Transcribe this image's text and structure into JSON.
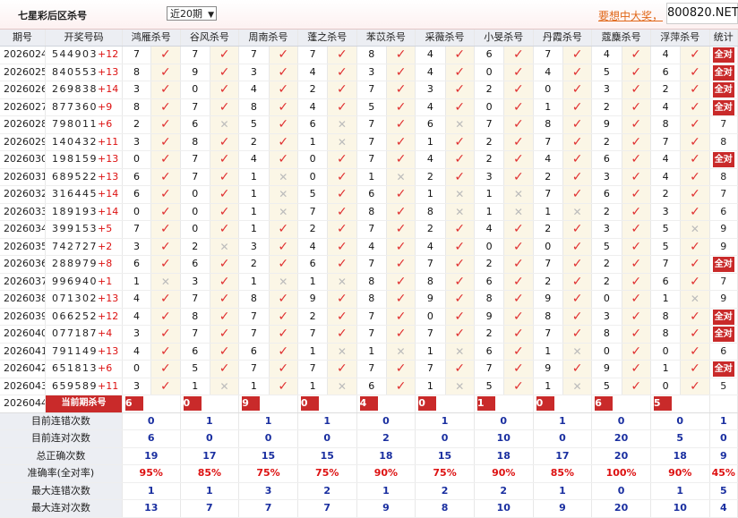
{
  "header": {
    "title": "七星彩后区杀号",
    "period_select": "近20期",
    "ad_text": "要想中大奖，",
    "watermark": "800820.NET"
  },
  "columns": [
    "期号",
    "开奖号码",
    "鸿雁杀号",
    "谷风杀号",
    "周南杀号",
    "蓬之杀号",
    "苯苡杀号",
    "采薇杀号",
    "小旻杀号",
    "丹霞杀号",
    "蔻麋杀号",
    "浮萍杀号",
    "统计"
  ],
  "rows": [
    {
      "issue": "2026024",
      "nums": "544903",
      "sum": "+12",
      "v": [
        "7",
        "7",
        "7",
        "7",
        "8",
        "4",
        "6",
        "7",
        "4",
        "4"
      ],
      "m": [
        "ok",
        "ok",
        "ok",
        "ok",
        "ok",
        "ok",
        "ok",
        "ok",
        "ok",
        "ok"
      ],
      "stat": "全对"
    },
    {
      "issue": "2026025",
      "nums": "840553",
      "sum": "+13",
      "v": [
        "8",
        "9",
        "3",
        "4",
        "3",
        "4",
        "0",
        "4",
        "5",
        "6"
      ],
      "m": [
        "ok",
        "ok",
        "ok",
        "ok",
        "ok",
        "ok",
        "ok",
        "ok",
        "ok",
        "ok"
      ],
      "stat": "全对"
    },
    {
      "issue": "2026026",
      "nums": "269838",
      "sum": "+14",
      "v": [
        "3",
        "0",
        "4",
        "2",
        "7",
        "3",
        "2",
        "0",
        "3",
        "2"
      ],
      "m": [
        "ok",
        "ok",
        "ok",
        "ok",
        "ok",
        "ok",
        "ok",
        "ok",
        "ok",
        "ok"
      ],
      "stat": "全对"
    },
    {
      "issue": "2026027",
      "nums": "877360",
      "sum": "+9",
      "v": [
        "8",
        "7",
        "8",
        "4",
        "5",
        "4",
        "0",
        "1",
        "2",
        "4"
      ],
      "m": [
        "ok",
        "ok",
        "ok",
        "ok",
        "ok",
        "ok",
        "ok",
        "ok",
        "ok",
        "ok"
      ],
      "stat": "全对"
    },
    {
      "issue": "2026028",
      "nums": "798011",
      "sum": "+6",
      "v": [
        "2",
        "6",
        "5",
        "6",
        "7",
        "6",
        "7",
        "8",
        "9",
        "8"
      ],
      "m": [
        "ok",
        "no",
        "ok",
        "no",
        "ok",
        "no",
        "ok",
        "ok",
        "ok",
        "ok"
      ],
      "stat": "7"
    },
    {
      "issue": "2026029",
      "nums": "140432",
      "sum": "+11",
      "v": [
        "3",
        "8",
        "2",
        "1",
        "7",
        "1",
        "2",
        "7",
        "2",
        "7"
      ],
      "m": [
        "ok",
        "ok",
        "ok",
        "no",
        "ok",
        "ok",
        "ok",
        "ok",
        "ok",
        "ok"
      ],
      "stat": "8"
    },
    {
      "issue": "2026030",
      "nums": "198159",
      "sum": "+13",
      "v": [
        "0",
        "7",
        "4",
        "0",
        "7",
        "4",
        "2",
        "4",
        "6",
        "4"
      ],
      "m": [
        "ok",
        "ok",
        "ok",
        "ok",
        "ok",
        "ok",
        "ok",
        "ok",
        "ok",
        "ok"
      ],
      "stat": "全对"
    },
    {
      "issue": "2026031",
      "nums": "689522",
      "sum": "+13",
      "v": [
        "6",
        "7",
        "1",
        "0",
        "1",
        "2",
        "3",
        "2",
        "3",
        "4"
      ],
      "m": [
        "ok",
        "ok",
        "no",
        "ok",
        "no",
        "ok",
        "ok",
        "ok",
        "ok",
        "ok"
      ],
      "stat": "8"
    },
    {
      "issue": "2026032",
      "nums": "316445",
      "sum": "+14",
      "v": [
        "6",
        "0",
        "1",
        "5",
        "6",
        "1",
        "1",
        "7",
        "6",
        "2"
      ],
      "m": [
        "ok",
        "ok",
        "no",
        "ok",
        "ok",
        "no",
        "no",
        "ok",
        "ok",
        "ok"
      ],
      "stat": "7"
    },
    {
      "issue": "2026033",
      "nums": "189193",
      "sum": "+14",
      "v": [
        "0",
        "0",
        "1",
        "7",
        "8",
        "8",
        "1",
        "1",
        "2",
        "3"
      ],
      "m": [
        "ok",
        "ok",
        "no",
        "ok",
        "ok",
        "no",
        "no",
        "no",
        "ok",
        "ok"
      ],
      "stat": "6"
    },
    {
      "issue": "2026034",
      "nums": "399153",
      "sum": "+5",
      "v": [
        "7",
        "0",
        "1",
        "2",
        "7",
        "2",
        "4",
        "2",
        "3",
        "5"
      ],
      "m": [
        "ok",
        "ok",
        "ok",
        "ok",
        "ok",
        "ok",
        "ok",
        "ok",
        "ok",
        "no"
      ],
      "stat": "9"
    },
    {
      "issue": "2026035",
      "nums": "742727",
      "sum": "+2",
      "v": [
        "3",
        "2",
        "3",
        "4",
        "4",
        "4",
        "0",
        "0",
        "5",
        "5"
      ],
      "m": [
        "ok",
        "no",
        "ok",
        "ok",
        "ok",
        "ok",
        "ok",
        "ok",
        "ok",
        "ok"
      ],
      "stat": "9"
    },
    {
      "issue": "2026036",
      "nums": "288979",
      "sum": "+8",
      "v": [
        "6",
        "6",
        "2",
        "6",
        "7",
        "7",
        "2",
        "7",
        "2",
        "7"
      ],
      "m": [
        "ok",
        "ok",
        "ok",
        "ok",
        "ok",
        "ok",
        "ok",
        "ok",
        "ok",
        "ok"
      ],
      "stat": "全对"
    },
    {
      "issue": "2026037",
      "nums": "996940",
      "sum": "+1",
      "v": [
        "1",
        "3",
        "1",
        "1",
        "8",
        "8",
        "6",
        "2",
        "2",
        "6"
      ],
      "m": [
        "no",
        "ok",
        "no",
        "no",
        "ok",
        "ok",
        "ok",
        "ok",
        "ok",
        "ok"
      ],
      "stat": "7"
    },
    {
      "issue": "2026038",
      "nums": "071302",
      "sum": "+13",
      "v": [
        "4",
        "7",
        "8",
        "9",
        "8",
        "9",
        "8",
        "9",
        "0",
        "1"
      ],
      "m": [
        "ok",
        "ok",
        "ok",
        "ok",
        "ok",
        "ok",
        "ok",
        "ok",
        "ok",
        "no"
      ],
      "stat": "9"
    },
    {
      "issue": "2026039",
      "nums": "066252",
      "sum": "+12",
      "v": [
        "4",
        "8",
        "7",
        "2",
        "7",
        "0",
        "9",
        "8",
        "3",
        "8"
      ],
      "m": [
        "ok",
        "ok",
        "ok",
        "ok",
        "ok",
        "ok",
        "ok",
        "ok",
        "ok",
        "ok"
      ],
      "stat": "全对"
    },
    {
      "issue": "2026040",
      "nums": "077187",
      "sum": "+4",
      "v": [
        "3",
        "7",
        "7",
        "7",
        "7",
        "7",
        "2",
        "7",
        "8",
        "8"
      ],
      "m": [
        "ok",
        "ok",
        "ok",
        "ok",
        "ok",
        "ok",
        "ok",
        "ok",
        "ok",
        "ok"
      ],
      "stat": "全对"
    },
    {
      "issue": "2026041",
      "nums": "791149",
      "sum": "+13",
      "v": [
        "4",
        "6",
        "6",
        "1",
        "1",
        "1",
        "6",
        "1",
        "0",
        "0"
      ],
      "m": [
        "ok",
        "ok",
        "ok",
        "no",
        "no",
        "no",
        "ok",
        "no",
        "ok",
        "ok"
      ],
      "stat": "6"
    },
    {
      "issue": "2026042",
      "nums": "651813",
      "sum": "+6",
      "v": [
        "0",
        "5",
        "7",
        "7",
        "7",
        "7",
        "7",
        "9",
        "9",
        "1"
      ],
      "m": [
        "ok",
        "ok",
        "ok",
        "ok",
        "ok",
        "ok",
        "ok",
        "ok",
        "ok",
        "ok"
      ],
      "stat": "全对"
    },
    {
      "issue": "2026043",
      "nums": "659589",
      "sum": "+11",
      "v": [
        "3",
        "1",
        "1",
        "1",
        "6",
        "1",
        "5",
        "1",
        "5",
        "0"
      ],
      "m": [
        "ok",
        "no",
        "ok",
        "no",
        "ok",
        "no",
        "ok",
        "no",
        "ok",
        "ok"
      ],
      "stat": "5"
    }
  ],
  "current": {
    "issue": "2026044",
    "label": "当前期杀号",
    "first": "6",
    "values": [
      "0",
      "9",
      "0",
      "4",
      "0",
      "1",
      "0",
      "6",
      "5"
    ]
  },
  "stats": [
    {
      "label": "目前连错次数",
      "values": [
        "0",
        "1",
        "1",
        "1",
        "0",
        "1",
        "0",
        "1",
        "0",
        "0"
      ],
      "total": "1",
      "color": "blue"
    },
    {
      "label": "目前连对次数",
      "values": [
        "6",
        "0",
        "0",
        "0",
        "2",
        "0",
        "10",
        "0",
        "20",
        "5"
      ],
      "total": "0",
      "color": "blue"
    },
    {
      "label": "总正确次数",
      "values": [
        "19",
        "17",
        "15",
        "15",
        "18",
        "15",
        "18",
        "17",
        "20",
        "18"
      ],
      "total": "9",
      "color": "blue"
    },
    {
      "label": "准确率(全对率)",
      "values": [
        "95%",
        "85%",
        "75%",
        "75%",
        "90%",
        "75%",
        "90%",
        "85%",
        "100%",
        "90%"
      ],
      "total": "45%",
      "color": "red"
    },
    {
      "label": "最大连错次数",
      "values": [
        "1",
        "1",
        "3",
        "2",
        "1",
        "2",
        "2",
        "1",
        "0",
        "1"
      ],
      "total": "5",
      "color": "blue"
    },
    {
      "label": "最大连对次数",
      "values": [
        "13",
        "7",
        "7",
        "7",
        "9",
        "8",
        "10",
        "9",
        "20",
        "10"
      ],
      "total": "4",
      "color": "blue"
    }
  ],
  "marks": {
    "ok": "✓",
    "no": "✕"
  }
}
